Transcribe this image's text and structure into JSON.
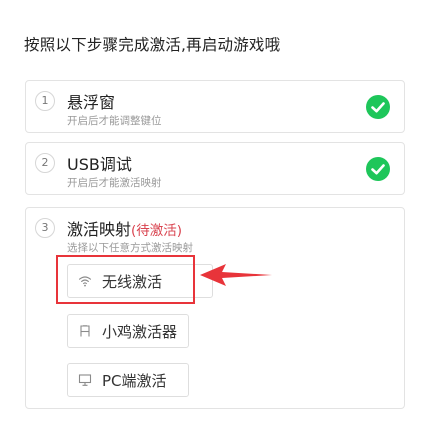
{
  "header": {
    "instruction": "按照以下步骤完成激活,再启动游戏哦"
  },
  "steps": [
    {
      "number": "1",
      "title": "悬浮窗",
      "description": "开启后才能调整键位",
      "icon": "check-circle-icon"
    },
    {
      "number": "2",
      "title": "USB调试",
      "description": "开启后才能激活映射",
      "icon": "check-circle-icon"
    },
    {
      "number": "3",
      "title": "激活映射",
      "status": "(待激活)",
      "description": "选择以下任意方式激活映射",
      "methods": [
        {
          "label": "无线激活",
          "icon": "wifi-icon"
        },
        {
          "label": "小鸡激活器",
          "icon": "chick-activator-icon"
        },
        {
          "label": "PC端激活",
          "icon": "monitor-icon"
        }
      ]
    }
  ],
  "colors": {
    "check_green": "#1ec65a",
    "status_red": "#d9434f",
    "highlight_red": "#e8343a",
    "border": "#e3e3e3",
    "text_muted": "#9a9a9a"
  }
}
